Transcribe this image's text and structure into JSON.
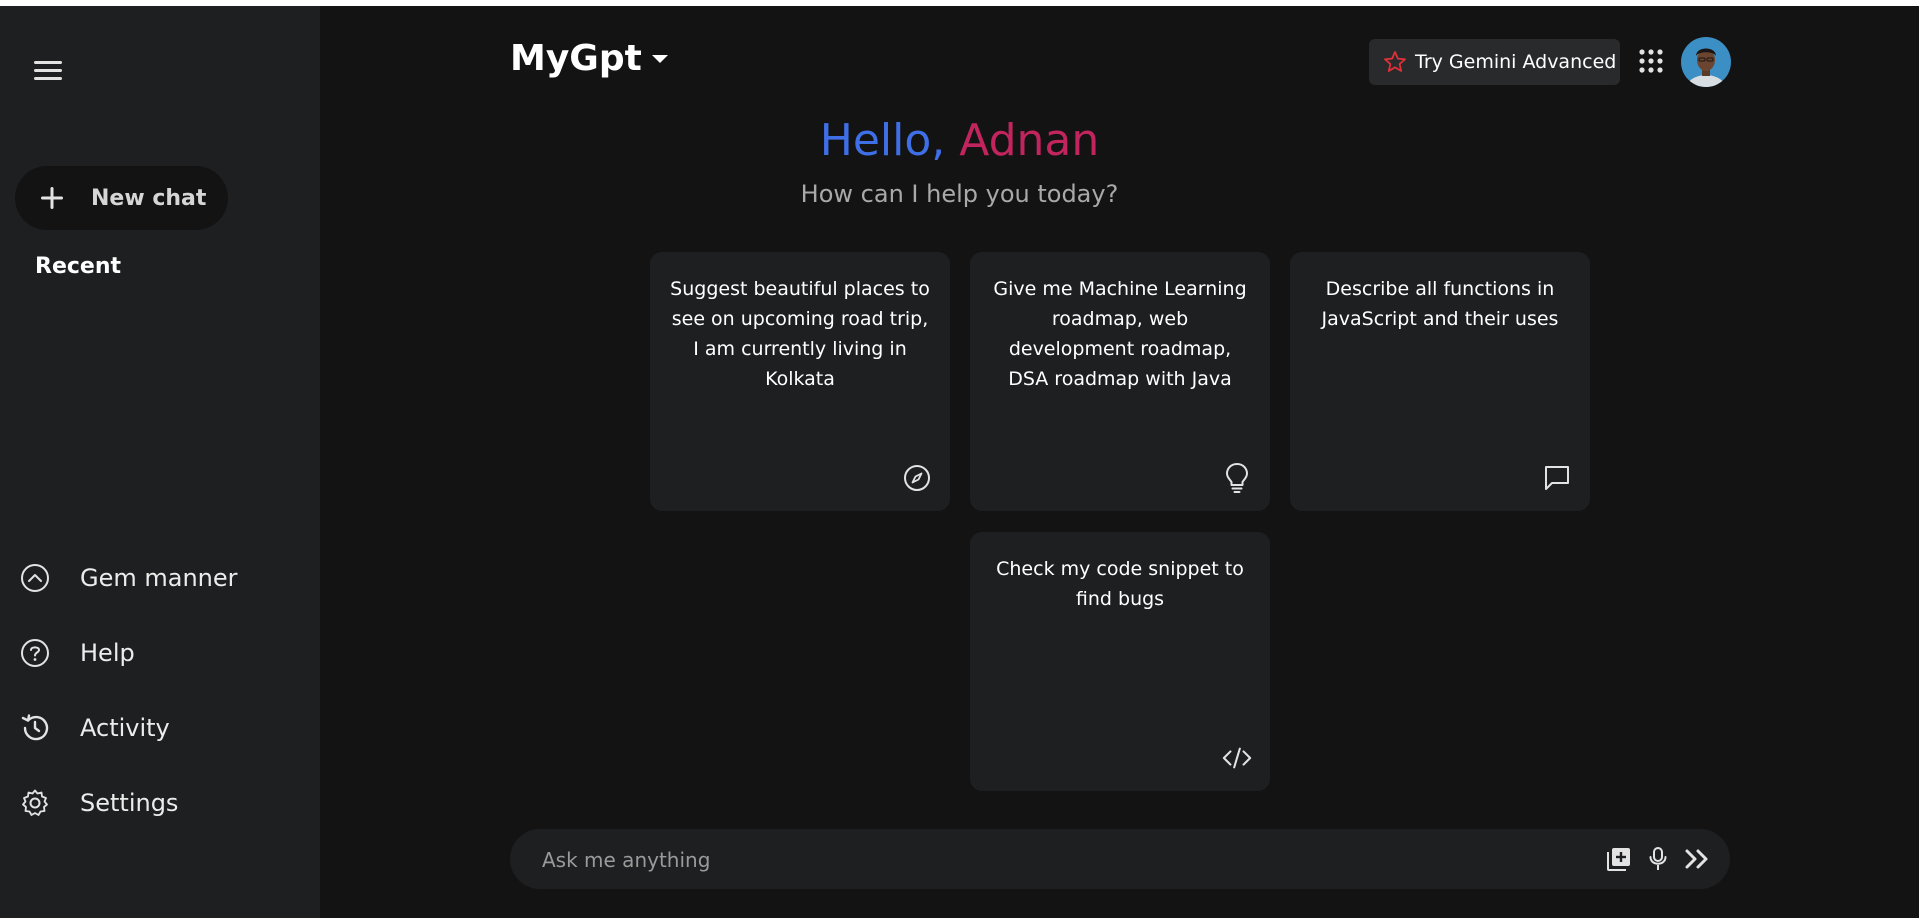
{
  "app": {
    "title": "MyGpt"
  },
  "sidebar": {
    "new_chat_label": "New chat",
    "recent_label": "Recent",
    "items": [
      {
        "label": "Gem manner",
        "icon": "chevron-up-circle-icon"
      },
      {
        "label": "Help",
        "icon": "help-circle-icon"
      },
      {
        "label": "Activity",
        "icon": "history-icon"
      },
      {
        "label": "Settings",
        "icon": "gear-icon"
      }
    ]
  },
  "header": {
    "try_label": "Try Gemini Advanced"
  },
  "greeting": {
    "hello": "Hello,",
    "name": "Adnan",
    "subtitle": "How can I help you today?"
  },
  "cards": [
    {
      "text": "Suggest beautiful places to see on upcoming road trip, I am currently living in Kolkata",
      "icon": "compass-icon"
    },
    {
      "text": "Give me Machine Learning roadmap, web development roadmap, DSA roadmap with Java",
      "icon": "lightbulb-icon"
    },
    {
      "text": "Describe all functions in JavaScript and their uses",
      "icon": "message-icon"
    },
    {
      "text": "Check my code snippet to find bugs",
      "icon": "code-icon"
    }
  ],
  "prompt": {
    "placeholder": "Ask me anything"
  },
  "colors": {
    "hello_blue": "#3f6fe6",
    "name_pink": "#c2245d",
    "star_red": "#e0303a"
  }
}
